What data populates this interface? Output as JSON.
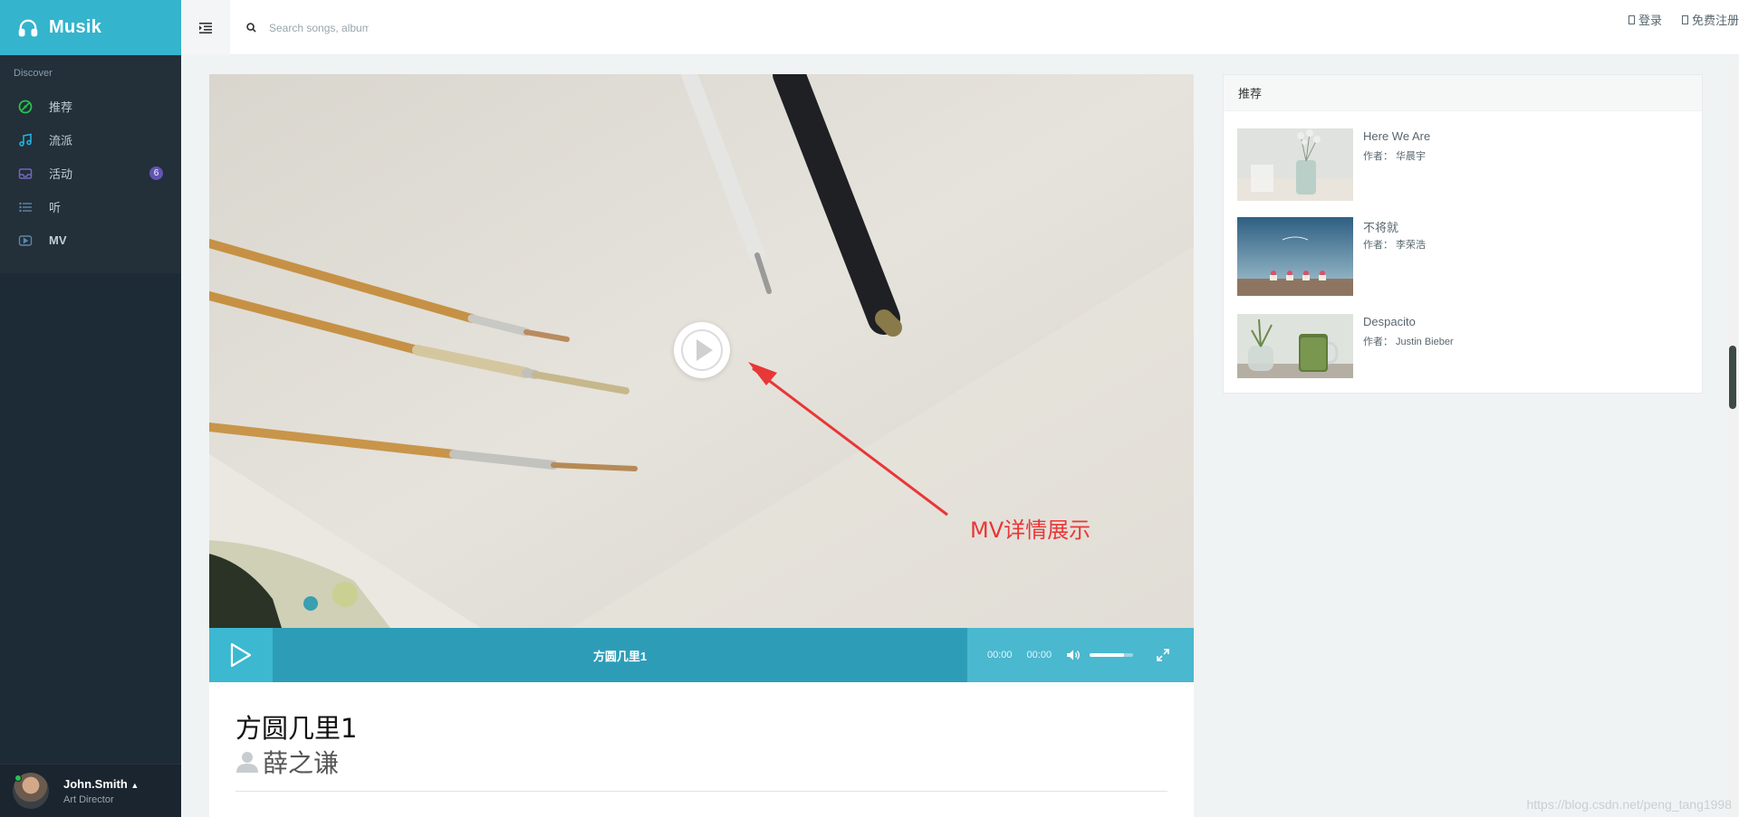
{
  "brand": {
    "name": "Musik"
  },
  "sidebar": {
    "section_header": "Discover",
    "items": [
      {
        "label": "推荐",
        "icon": "disc-icon",
        "color": "#27c24c"
      },
      {
        "label": "流派",
        "icon": "music-note-icon",
        "color": "#23b7e5"
      },
      {
        "label": "活动",
        "icon": "envelope-icon",
        "color": "#7266ba",
        "badge": "6"
      },
      {
        "label": "听",
        "icon": "list-icon",
        "color": "#5d87a8"
      },
      {
        "label": "MV",
        "icon": "video-icon",
        "color": "#5d87a8"
      }
    ]
  },
  "user": {
    "name": "John.Smith",
    "role": "Art Director"
  },
  "header": {
    "search_placeholder": "Search songs, albums...",
    "login_label": "登录",
    "register_label": "免费注册"
  },
  "player": {
    "title": "方圆几里1",
    "current_time": "00:00",
    "duration": "00:00",
    "volume": 0.8
  },
  "annotation": "MV详情展示",
  "mv": {
    "title": "方圆几里1",
    "artist": "薛之谦"
  },
  "recommend": {
    "title": "推荐",
    "items": [
      {
        "name": "Here We Are",
        "author": "作者： 华晨宇"
      },
      {
        "name": "不将就",
        "author": "作者： 李荣浩"
      },
      {
        "name": "Despacito",
        "author": "作者： Justin Bieber"
      }
    ]
  },
  "watermark": "https://blog.csdn.net/peng_tang1998"
}
